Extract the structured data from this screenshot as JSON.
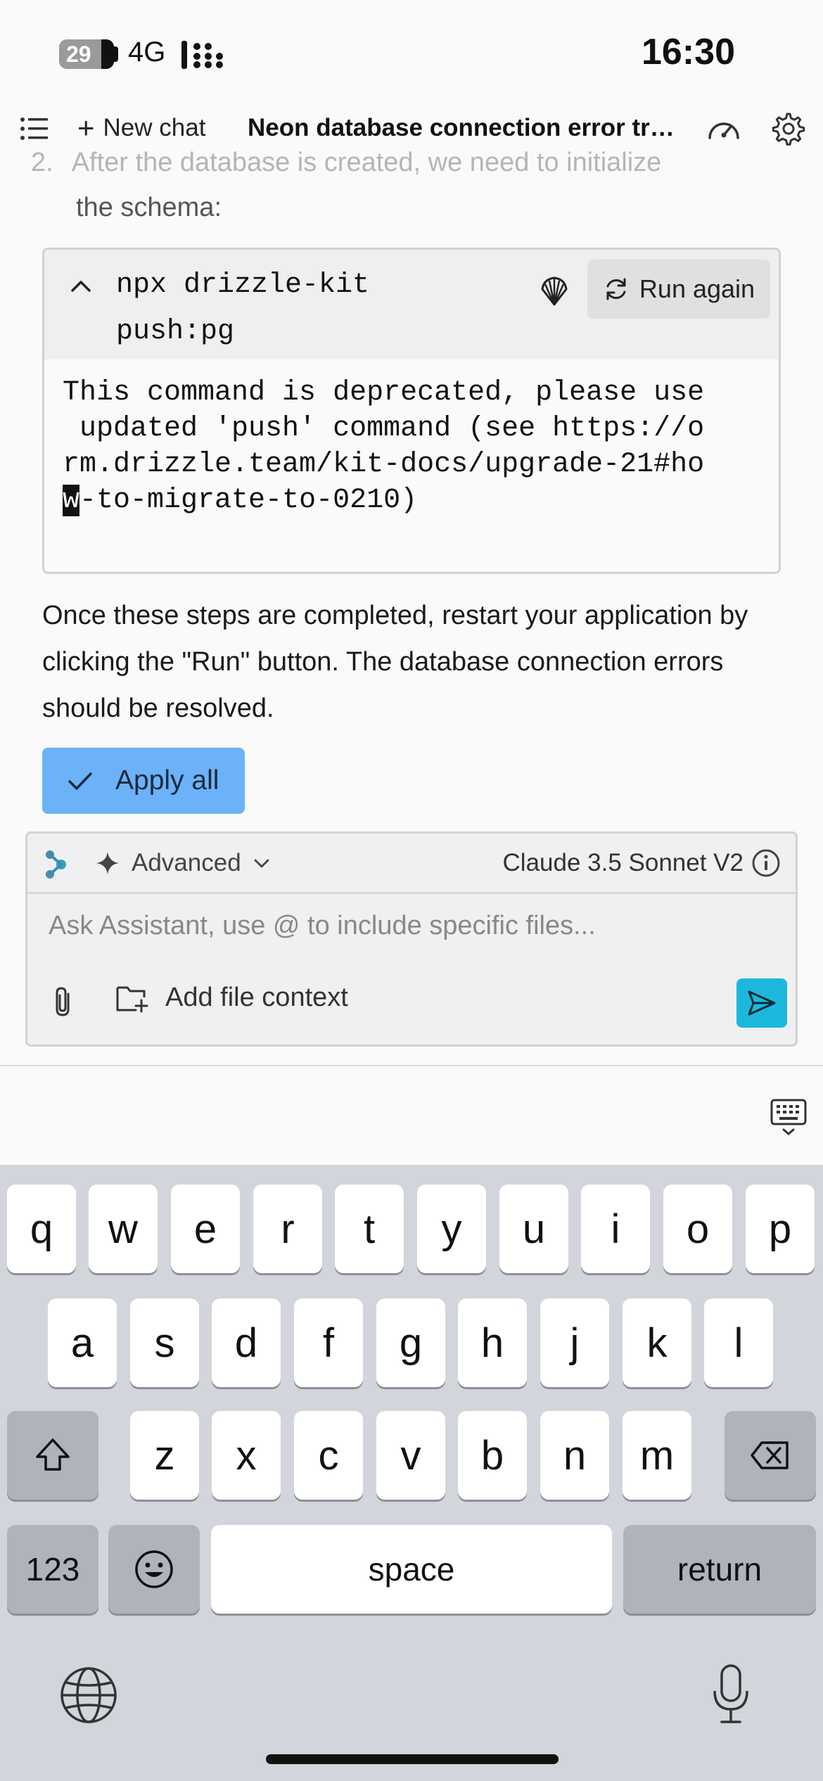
{
  "status_bar": {
    "battery": "29",
    "network": "4G",
    "time": "16:30"
  },
  "header": {
    "menu_icon": "hamburger-menu-icon",
    "new_chat_label": "New chat",
    "title": "Neon database connection error tro...",
    "speed_icon": "gauge-icon",
    "settings_icon": "gear-icon"
  },
  "content": {
    "step_number": "2.",
    "step_text": "After the database is created, we need to initialize",
    "step_text_cont": "the schema:",
    "code_block": {
      "command_line1": "npx drizzle-kit",
      "command_line2": "push:pg",
      "run_again_label": "Run again",
      "output_lines": [
        "This command is deprecated, please use",
        " updated 'push' command (see https://o",
        "rm.drizzle.team/kit-docs/upgrade-21#ho",
        "-to-migrate-to-0210)"
      ],
      "cursor_char": "w"
    },
    "paragraph": "Once these steps are completed, restart your application by clicking the \"Run\" button. The database connection errors should be resolved.",
    "apply_all_label": "Apply all"
  },
  "composer": {
    "mode_label": "Advanced",
    "model_label": "Claude 3.5 Sonnet V2",
    "placeholder": "Ask Assistant, use @ to include specific files...",
    "add_file_context_label": "Add file context"
  },
  "keyboard": {
    "row1": [
      "q",
      "w",
      "e",
      "r",
      "t",
      "y",
      "u",
      "i",
      "o",
      "p"
    ],
    "row2": [
      "a",
      "s",
      "d",
      "f",
      "g",
      "h",
      "j",
      "k",
      "l"
    ],
    "row3": [
      "z",
      "x",
      "c",
      "v",
      "b",
      "n",
      "m"
    ],
    "numbers_label": "123",
    "space_label": "space",
    "return_label": "return"
  },
  "colors": {
    "apply_button": "#6cb2f8",
    "send_button": "#1cb8dc",
    "keyboard_bg": "#d2d5db"
  }
}
